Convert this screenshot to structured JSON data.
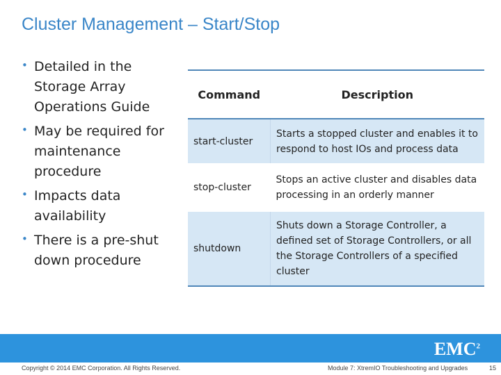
{
  "title": "Cluster Management – Start/Stop",
  "bullets": [
    "Detailed in the Storage Array Operations Guide",
    "May be required for maintenance procedure",
    "Impacts data availability",
    "There is a pre-shut down procedure"
  ],
  "table": {
    "headers": [
      "Command",
      "Description"
    ],
    "rows": [
      {
        "command": "start-cluster",
        "description": "Starts a stopped cluster and enables it to respond to host IOs and process data"
      },
      {
        "command": "stop-cluster",
        "description": "Stops an active cluster and disables data processing in an orderly manner"
      },
      {
        "command": "shutdown",
        "description": "Shuts down a Storage Controller, a defined set of Storage Controllers, or all the Storage Controllers of a specified cluster"
      }
    ]
  },
  "footer": {
    "logo": "EMC2",
    "copyright": "Copyright © 2014 EMC Corporation. All Rights Reserved.",
    "module": "Module 7: XtremIO Troubleshooting and Upgrades",
    "page": "15"
  },
  "colors": {
    "accent": "#3a86c8",
    "band": "#2d93dd",
    "row_shade": "#d6e7f5"
  }
}
